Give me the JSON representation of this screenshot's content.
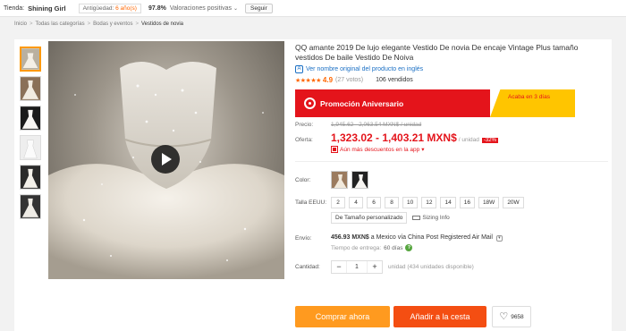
{
  "store": {
    "label": "Tienda:",
    "name": "Shining Girl",
    "age_label": "Antigüedad:",
    "age_value": "6 año(s)",
    "rating": "97.8%",
    "rating_label": "Valoraciones positivas",
    "follow_label": "Seguir"
  },
  "breadcrumb": [
    "Inicio",
    "Todas las categorías",
    "Bodas y eventos",
    "Vestidos de novia"
  ],
  "product": {
    "title": "QQ amante 2019 De lujo elegante Vestido De novia De encaje Vintage Plus tamaño vestidos De baile Vestido De Noiva",
    "original_link": "Ver nombre original del producto en inglés",
    "stars": "★★★★★",
    "score": "4.9",
    "votes": "(27 votos)",
    "orders": "106 vendidos"
  },
  "promo": {
    "label": "Promoción Aniversario",
    "ends": "Acaba en 3 días"
  },
  "price": {
    "price_label": "Precio:",
    "old_price": "1,945.62 - 2,063.54 MXN$ / unidad",
    "offer_label": "Oferta:",
    "new_price": "1,323.02 - 1,403.21 MXN$",
    "unit": "/ unidad",
    "discount": "-32%",
    "more_discounts": "Aún más descuentos en la app",
    "accent": "#e4141b"
  },
  "options": {
    "color_label": "Color:",
    "size_label": "Talla EEUU:",
    "sizes": [
      "2",
      "4",
      "6",
      "8",
      "10",
      "12",
      "14",
      "16",
      "18W",
      "20W"
    ],
    "custom_size": "De Tamaño personalizado",
    "sizing_info": "Sizing Info"
  },
  "shipping": {
    "label": "Envío:",
    "cost": "456.93 MXN$",
    "route": "a Mexico vía China Post Registered Air Mail",
    "time_label": "Tiempo de entrega:",
    "time_value": "60 días"
  },
  "quantity": {
    "label": "Cantidad:",
    "minus": "−",
    "value": "1",
    "plus": "+",
    "available": "unidad (434 unidades disponible)"
  },
  "actions": {
    "buy": "Comprar ahora",
    "cart": "Añadir a la cesta",
    "wishlist_count": "9658"
  }
}
